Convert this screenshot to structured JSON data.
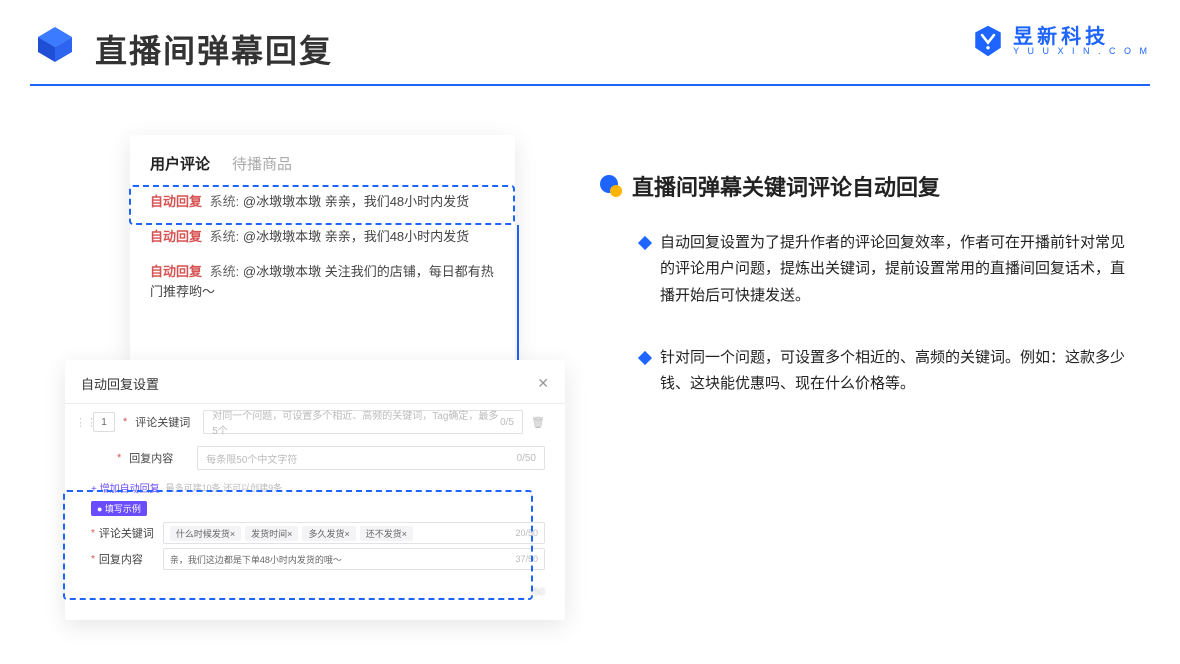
{
  "header": {
    "title": "直播间弹幕回复"
  },
  "logo": {
    "brand": "昱新科技",
    "url": "Y U U X I N . C O M"
  },
  "comments_panel": {
    "tabs": {
      "active": "用户评论",
      "inactive": "待播商品"
    },
    "rows": {
      "r1": {
        "tag": "自动回复",
        "sys": "系统:",
        "text": "@冰墩墩本墩 亲亲，我们48小时内发货"
      },
      "r2": {
        "tag": "自动回复",
        "sys": "系统:",
        "text": "@冰墩墩本墩 亲亲，我们48小时内发货"
      },
      "r3": {
        "tag": "自动回复",
        "sys": "系统:",
        "text": "@冰墩墩本墩 关注我们的店铺，每日都有热门推荐哟～"
      }
    }
  },
  "settings_modal": {
    "title": "自动回复设置",
    "order": "1",
    "keyword_label": "评论关键词",
    "keyword_placeholder": "对同一个问题，可设置多个相近、高频的关键词，Tag确定，最多5个",
    "keyword_count": "0/5",
    "content_label": "回复内容",
    "content_placeholder": "每条限50个中文字符",
    "content_count": "0/50",
    "add_link": "+ 增加自动回复",
    "add_hint": "最多可建10条 还可以创建9条",
    "example_tag": "● 填写示例",
    "ex_keyword_label": "评论关键词",
    "chips": {
      "c1": "什么时候发货×",
      "c2": "发货时间×",
      "c3": "多久发货×",
      "c4": "还不发货×"
    },
    "ex_keyword_count": "20/50",
    "ex_content_label": "回复内容",
    "ex_content_value": "亲，我们这边都是下单48小时内发货的哦～",
    "ex_content_count": "37/50",
    "blurred_count": "/50"
  },
  "right": {
    "heading": "直播间弹幕关键词评论自动回复",
    "b1": "自动回复设置为了提升作者的评论回复效率，作者可在开播前针对常见的评论用户问题，提炼出关键词，提前设置常用的直播间回复话术，直播开始后可快捷发送。",
    "b2": "针对同一个问题，可设置多个相近的、高频的关键词。例如：这款多少钱、这块能优惠吗、现在什么价格等。"
  }
}
